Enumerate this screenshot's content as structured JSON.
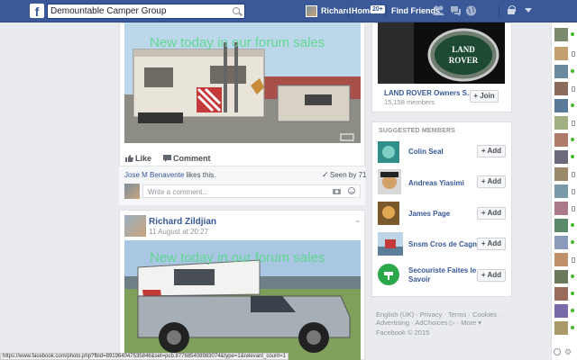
{
  "topbar": {
    "logo": "f",
    "search_value": "Demountable Camper Group",
    "user_name": "Richard",
    "home_label": "Home",
    "home_badge": "20+",
    "find_friends": "Find Friends"
  },
  "post1": {
    "overlay": "New today in our forum sales",
    "like": "Like",
    "comment": "Comment",
    "liker": "Jose M Benavente",
    "likes_suffix": " likes this.",
    "seen_by": "Seen by 71",
    "comment_placeholder": "Write a comment..."
  },
  "post2": {
    "author": "Richard Zildjian",
    "date": "11 August at 20:27",
    "overlay": "New today in our forum sales"
  },
  "group_card": {
    "name": "LAND ROVER Owners S...",
    "members": "15,158 members",
    "join": "Join"
  },
  "suggested": {
    "title": "SUGGESTED MEMBERS",
    "add_label": "Add",
    "members": [
      {
        "name": "Colin Seal"
      },
      {
        "name": "Andreas Yiasimi"
      },
      {
        "name": "James Page"
      },
      {
        "name": "Snsm Cros de Cagnes"
      },
      {
        "name": "Secouriste Faites le Savoir"
      }
    ]
  },
  "footer": {
    "line1": "English (UK) · Privacy · Terms · Cookies ·",
    "line2": "Advertising · AdChoices ▷ · More ▾",
    "line3": "Facebook © 2015"
  },
  "statusbar": "https://www.facebook.com/photo.php?fbid=891964047535846&set=pcb.877685408983074&type=1&relevant_count=1",
  "colors": {
    "brand": "#3b5998",
    "link": "#365899",
    "overlay_text": "#58d98a"
  }
}
